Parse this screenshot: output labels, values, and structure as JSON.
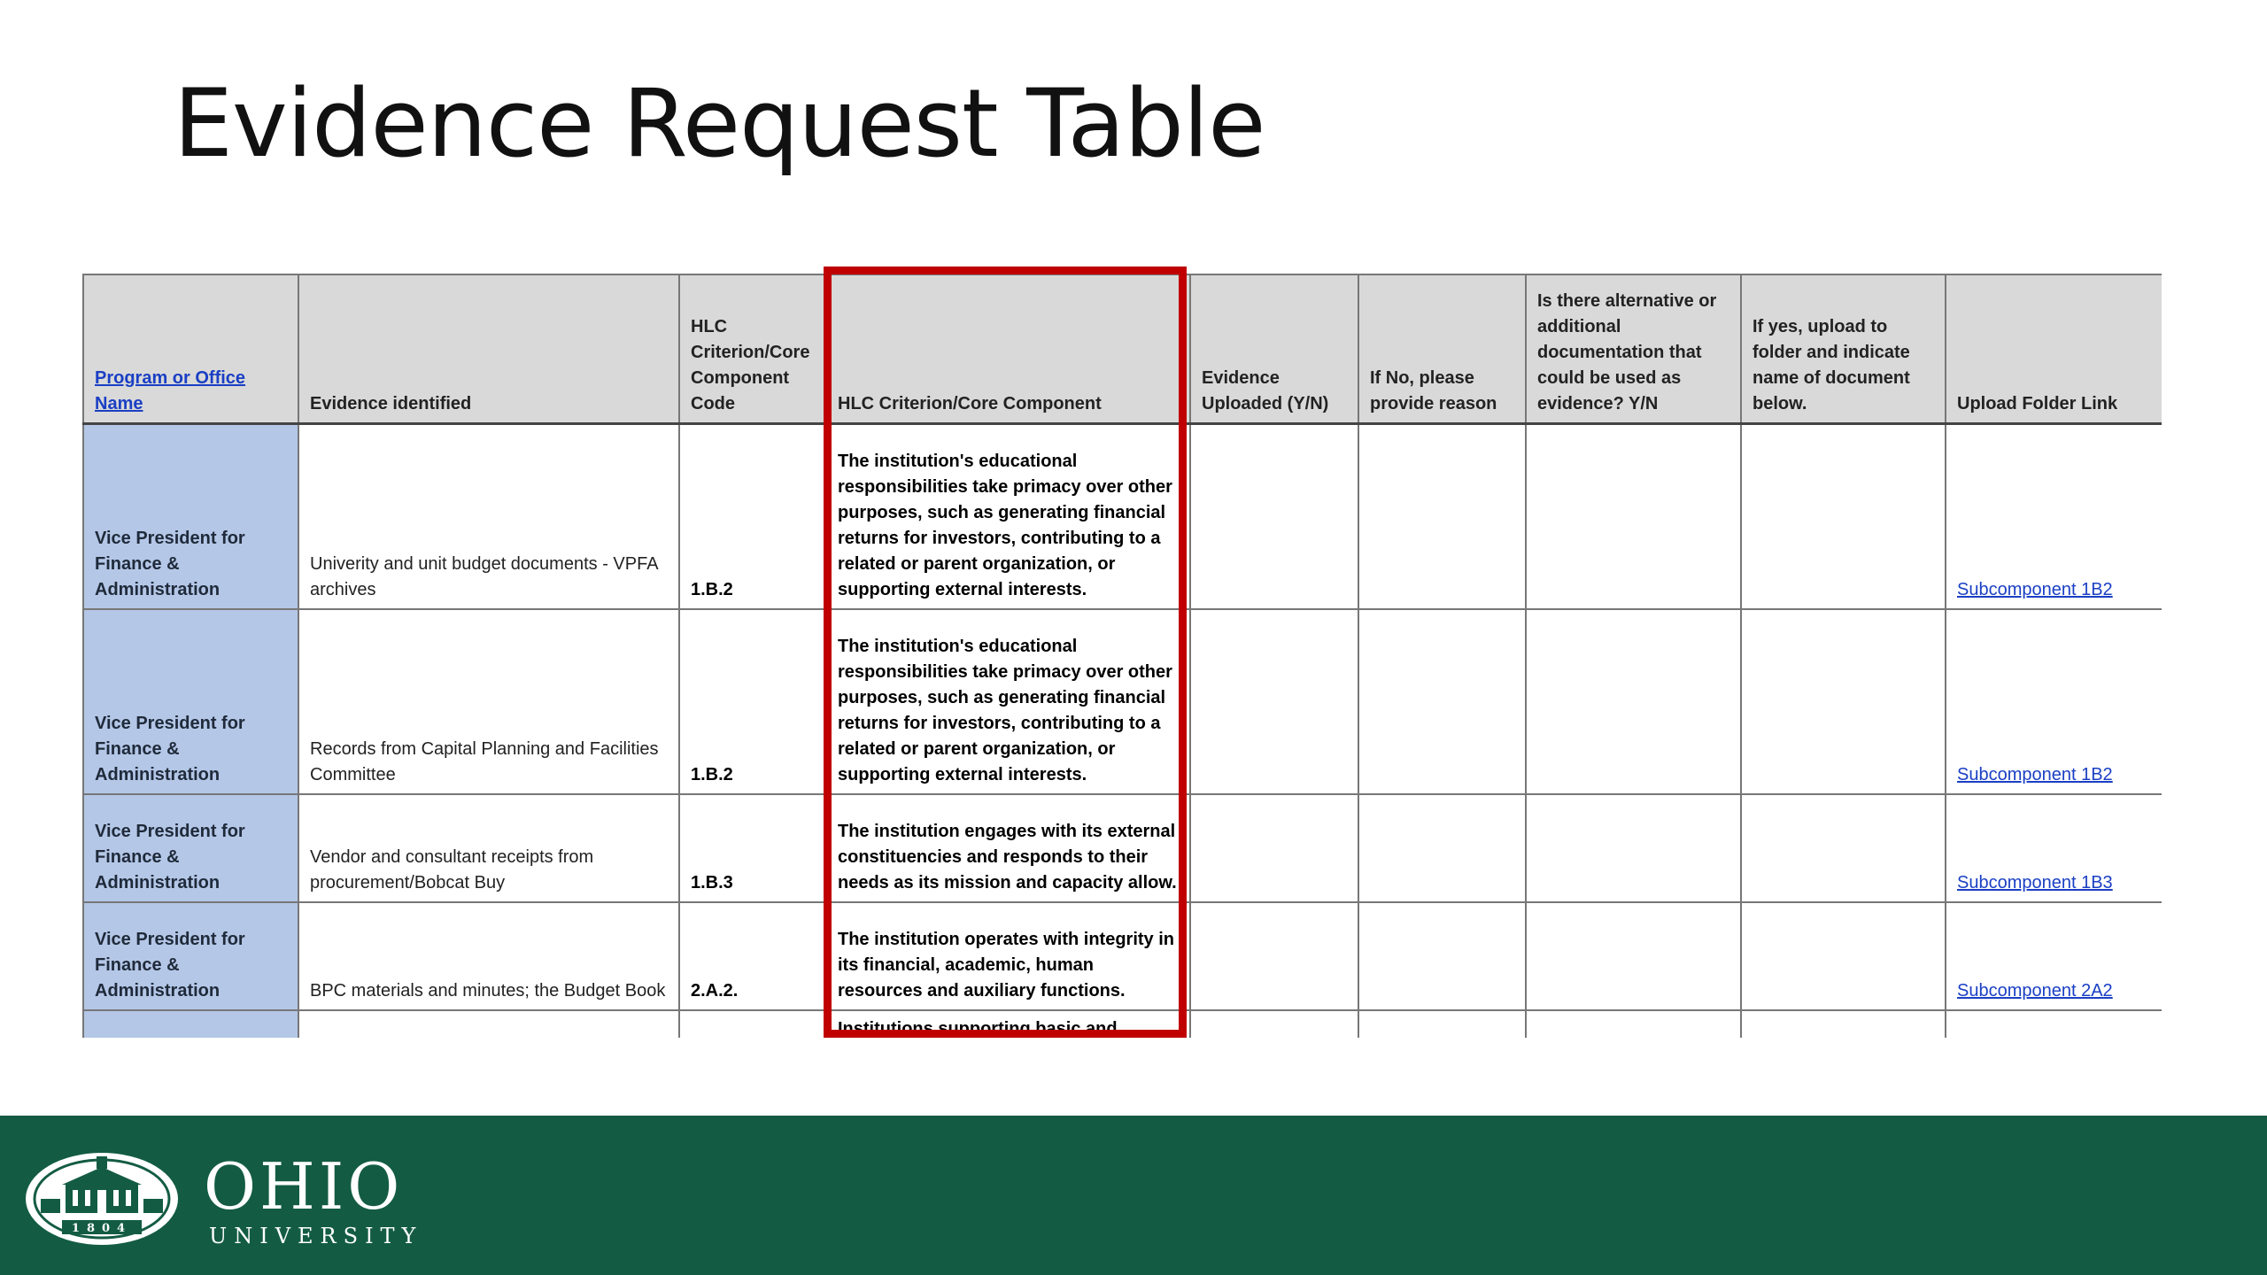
{
  "slide": {
    "title": "Evidence Request Table"
  },
  "table": {
    "headers": [
      "Program or Office Name",
      "Evidence identified",
      "HLC Criterion/Core Component Code",
      "HLC Criterion/Core Component",
      "Evidence Uploaded (Y/N)",
      "If No, please provide reason",
      "Is there alternative or additional documentation that could be used as evidence? Y/N",
      "If yes, upload to folder and indicate name of document below.",
      "Upload Folder Link"
    ],
    "rows": [
      {
        "office": "Vice President for Finance & Administration",
        "evidence": "Univerity and unit budget documents - VPFA archives",
        "code": "1.B.2",
        "criterion": "The institution's educational responsibilities take primacy over other purposes, such as generating financial returns for investors, contributing to a related or parent organization, or supporting external interests.",
        "link": "Subcomponent 1B2"
      },
      {
        "office": "Vice President for Finance & Administration",
        "evidence": "Records from Capital Planning and Facilities Committee",
        "code": "1.B.2",
        "criterion": "The institution's educational responsibilities take primacy over other purposes, such as generating financial returns for investors, contributing to a related or parent organization, or supporting external interests.",
        "link": "Subcomponent 1B2"
      },
      {
        "office": "Vice President for Finance & Administration",
        "evidence": "Vendor and consultant receipts from procurement/Bobcat Buy",
        "code": "1.B.3",
        "criterion": "The institution engages with its external constituencies and responds to their needs as its mission and capacity allow.",
        "link": "Subcomponent 1B3"
      },
      {
        "office": "Vice President for Finance & Administration",
        "evidence": "BPC materials and minutes; the Budget Book",
        "code": "2.A.2.",
        "criterion": "The institution operates with integrity in its financial, academic, human resources and auxiliary functions.",
        "link": "Subcomponent 2A2"
      }
    ],
    "partial_row": {
      "criterion": "Institutions supporting basic and"
    }
  },
  "footer": {
    "logo_word": "OHIO",
    "logo_sub": "UNIVERSITY",
    "seal_year": "1804"
  },
  "colors": {
    "footer_green": "#135c43",
    "highlight_red": "#c00000",
    "office_blue": "#b4c7e7",
    "header_gray": "#d9d9d9",
    "link_blue": "#1a3fc4"
  }
}
